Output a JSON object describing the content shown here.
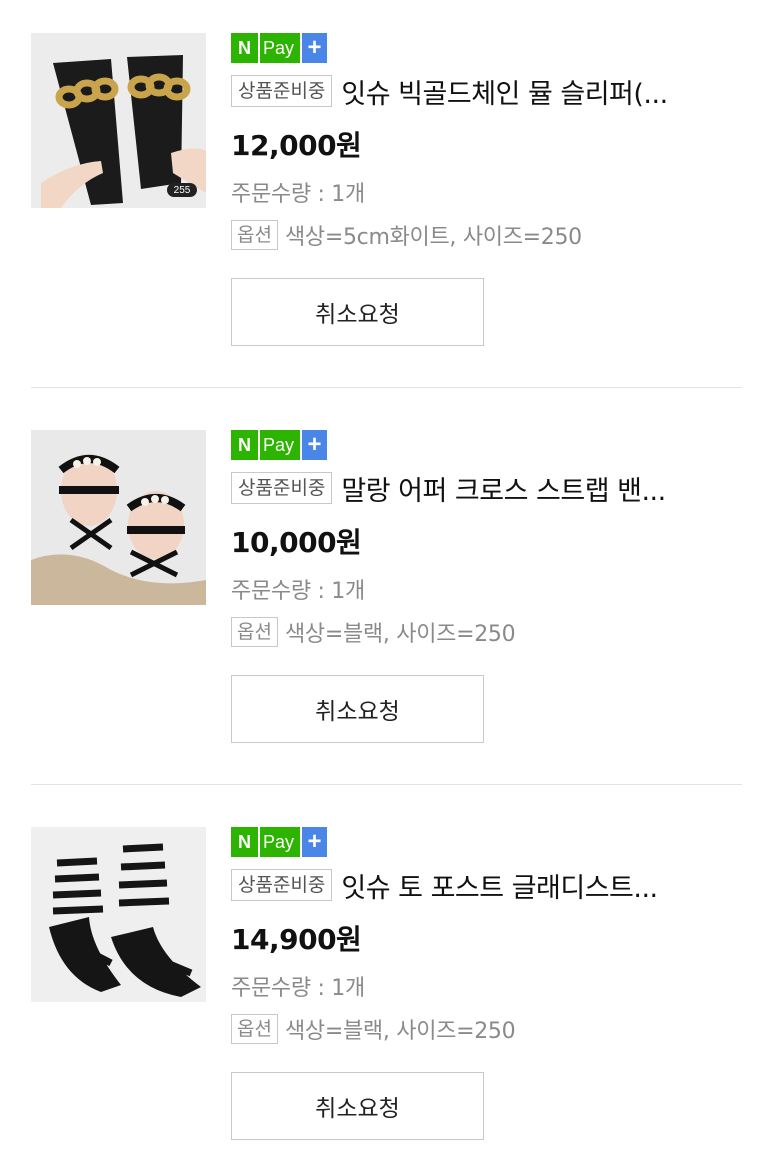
{
  "orders": [
    {
      "npay": {
        "n": "N",
        "pay": "Pay",
        "plus": "+"
      },
      "status": "상품준비중",
      "name": "잇슈 빅골드체인 뮬 슬리퍼(...",
      "price": "12,000원",
      "quantity": "주문수량 : 1개",
      "option_label": "옵션",
      "option_value": "색상=5cm화이트, 사이즈=250",
      "image_badge": "255",
      "cancel_label": "취소요청"
    },
    {
      "npay": {
        "n": "N",
        "pay": "Pay",
        "plus": "+"
      },
      "status": "상품준비중",
      "name": "말랑 어퍼 크로스 스트랩 밴...",
      "price": "10,000원",
      "quantity": "주문수량 : 1개",
      "option_label": "옵션",
      "option_value": "색상=블랙, 사이즈=250",
      "cancel_label": "취소요청"
    },
    {
      "npay": {
        "n": "N",
        "pay": "Pay",
        "plus": "+"
      },
      "status": "상품준비중",
      "name": "잇슈 토 포스트 글래디스트...",
      "price": "14,900원",
      "quantity": "주문수량 : 1개",
      "option_label": "옵션",
      "option_value": "색상=블랙, 사이즈=250",
      "cancel_label": "취소요청"
    }
  ],
  "colors": {
    "npay_green": "#2db400",
    "npay_blue": "#4a86e8",
    "muted_text": "#8a8a8a",
    "border": "#c8c8c8"
  },
  "icons": {
    "npay_logo": "npay-plus-icon"
  }
}
